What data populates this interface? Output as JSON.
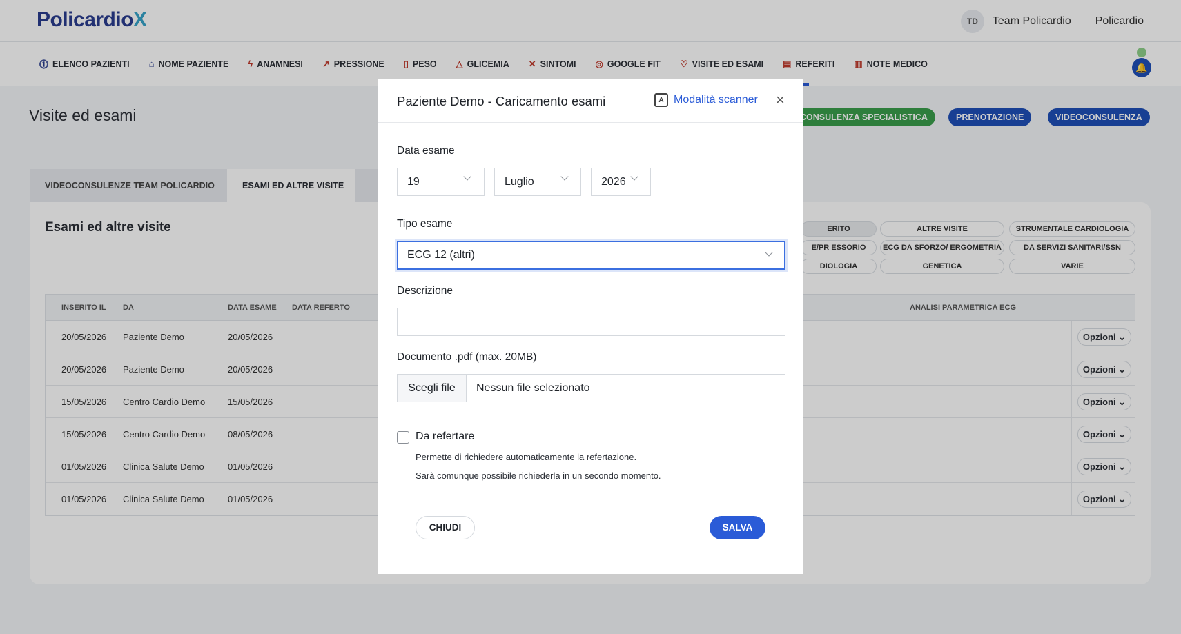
{
  "header": {
    "logo": "Policardio",
    "logo_suffix": "X",
    "avatar_initials": "TD",
    "team_name": "Team Policardio",
    "org_name": "Policardio"
  },
  "nav": {
    "items": [
      {
        "label": "ELENCO PAZIENTI",
        "icon": "list-icon"
      },
      {
        "label": "NOME PAZIENTE",
        "icon": "user-icon"
      },
      {
        "label": "ANAMNESI",
        "icon": "pulse-icon"
      },
      {
        "label": "PRESSIONE",
        "icon": "pressure-icon"
      },
      {
        "label": "PESO",
        "icon": "weight-icon"
      },
      {
        "label": "GLICEMIA",
        "icon": "flask-icon"
      },
      {
        "label": "SINTOMI",
        "icon": "symptom-icon"
      },
      {
        "label": "GOOGLE FIT",
        "icon": "google-fit-icon"
      },
      {
        "label": "VISITE ED ESAMI",
        "icon": "heart-icon"
      },
      {
        "label": "REFERITI",
        "icon": "document-icon"
      },
      {
        "label": "NOTE MEDICO",
        "icon": "chart-icon"
      }
    ]
  },
  "page": {
    "title": "Visite ed esami",
    "actions": [
      "CONSULENZA SPECIALISTICA",
      "PRENOTAZIONE",
      "VIDEOCONSULENZA"
    ],
    "tabs": [
      "VIDEOCONSULENZE TEAM POLICARDIO",
      "ESAMI ED ALTRE VISITE"
    ],
    "card_title": "Esami ed altre visite",
    "filters": [
      [
        "ERITO",
        "ALTRE VISITE",
        "STRUMENTALE CARDIOLOGIA"
      ],
      [
        "E/PR ESSORIO",
        "ECG DA SFORZO/ ERGOMETRIA",
        "DA SERVIZI SANITARI/SSN"
      ],
      [
        "DIOLOGIA",
        "GENETICA",
        "VARIE"
      ]
    ]
  },
  "table": {
    "headers": {
      "inserito": "INSERITO IL",
      "da": "DA",
      "data_esame": "DATA ESAME",
      "data_referto": "DATA REFERTO",
      "analisi": "ANALISI PARAMETRICA ECG"
    },
    "options_label": "Opzioni ⌄",
    "rows": [
      {
        "inserito": "20/05/2026",
        "da": "Paziente Demo",
        "data_esame": "20/05/2026"
      },
      {
        "inserito": "20/05/2026",
        "da": "Paziente Demo",
        "data_esame": "20/05/2026"
      },
      {
        "inserito": "15/05/2026",
        "da": "Centro Cardio Demo",
        "data_esame": "15/05/2026"
      },
      {
        "inserito": "15/05/2026",
        "da": "Centro Cardio Demo",
        "data_esame": "08/05/2026"
      },
      {
        "inserito": "01/05/2026",
        "da": "Clinica Salute Demo",
        "data_esame": "01/05/2026"
      },
      {
        "inserito": "01/05/2026",
        "da": "Clinica Salute Demo",
        "data_esame": "01/05/2026"
      }
    ]
  },
  "modal": {
    "title": "Paziente Demo - Caricamento esami",
    "scanner_icon_text": "A",
    "scanner_label": "Modalità scanner",
    "close_symbol": "×",
    "date_label": "Data esame",
    "day": "19",
    "month": "Luglio",
    "year": "2026",
    "type_label": "Tipo esame",
    "type_value": "ECG 12 (altri)",
    "description_label": "Descrizione",
    "description_value": "",
    "document_label": "Documento .pdf (max. 20MB)",
    "file_button": "Scegli file",
    "file_name": "Nessun file selezionato",
    "checkbox_label": "Da refertare",
    "hint_1": "Permette di richiedere automaticamente la refertazione.",
    "hint_2": "Sarà comunque possibile richiederla in un secondo momento.",
    "close_button": "CHIUDI",
    "save_button": "SALVA"
  }
}
